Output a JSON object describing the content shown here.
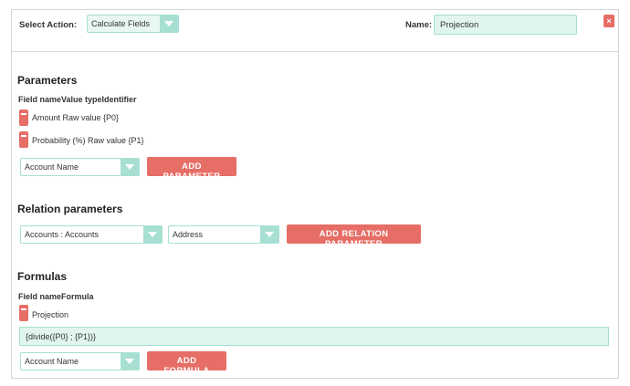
{
  "header": {
    "select_action_label": "Select Action:",
    "select_action_value": "Calculate Fields",
    "name_label": "Name:",
    "name_value": "Projection",
    "close_label": "×"
  },
  "parameters": {
    "title": "Parameters",
    "columns_header": "Field nameValue typeIdentifier",
    "rows": [
      {
        "text": "Amount Raw value {P0}"
      },
      {
        "text": "Probability (%) Raw value {P1}"
      }
    ],
    "field_select_value": "Account Name",
    "add_button": "ADD PARAMETER"
  },
  "relation_parameters": {
    "title": "Relation parameters",
    "relation_select_value": "Accounts : Accounts",
    "field_select_value": "Address",
    "add_button": "ADD RELATION PARAMETER"
  },
  "formulas": {
    "title": "Formulas",
    "columns_header": "Field nameFormula",
    "rows": [
      {
        "text": "Projection"
      }
    ],
    "formula_value": "{divide({P0} ; {P1})}",
    "field_select_value": "Account Name",
    "add_button": "ADD FORMULA"
  }
}
